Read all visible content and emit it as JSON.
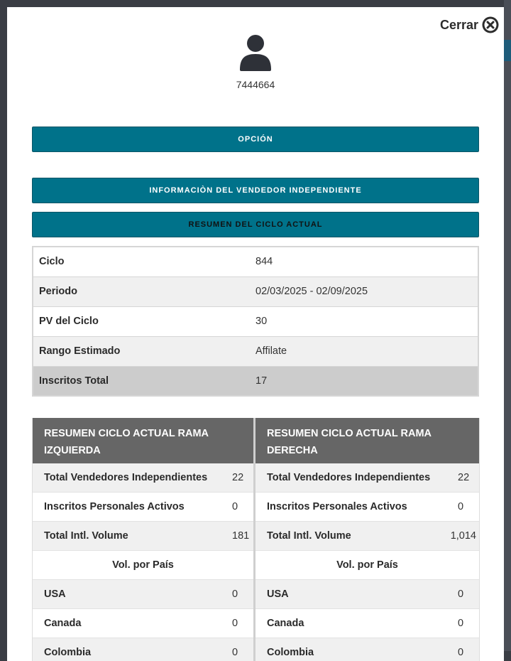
{
  "modal": {
    "close_label": "Cerrar",
    "user_id": "7444664"
  },
  "buttons": {
    "option": "OPCIÓN",
    "vendor_info": "INFORMACIÒN DEL VENDEDOR INDEPENDIENTE",
    "cycle_summary": "RESUMEN DEL CICLO ACTUAL"
  },
  "summary": [
    {
      "label": "Ciclo",
      "value": "844"
    },
    {
      "label": "Periodo",
      "value": "02/03/2025 - 02/09/2025"
    },
    {
      "label": "PV del Ciclo",
      "value": "30"
    },
    {
      "label": "Rango Estimado",
      "value": "Affilate"
    },
    {
      "label": "Inscritos Total",
      "value": "17"
    }
  ],
  "left": {
    "title": "RESUMEN CICLO ACTUAL RAMA IZQUIERDA",
    "rows": [
      {
        "label": "Total Vendedores Independientes",
        "value": "22"
      },
      {
        "label": "Inscritos Personales Activos",
        "value": "0"
      },
      {
        "label": "Total Intl. Volume",
        "value": "181"
      },
      {
        "label": "Vol. por País",
        "value": ""
      },
      {
        "label": "USA",
        "value": "0"
      },
      {
        "label": "Canada",
        "value": "0"
      },
      {
        "label": "Colombia",
        "value": "0"
      }
    ]
  },
  "right": {
    "title": "RESUMEN CICLO ACTUAL RAMA DERECHA",
    "rows": [
      {
        "label": "Total Vendedores Independientes",
        "value": "22"
      },
      {
        "label": "Inscritos Personales Activos",
        "value": "0"
      },
      {
        "label": "Total Intl. Volume",
        "value": "1,014"
      },
      {
        "label": "Vol. por País",
        "value": ""
      },
      {
        "label": "USA",
        "value": "0"
      },
      {
        "label": "Canada",
        "value": "0"
      },
      {
        "label": "Colombia",
        "value": "0"
      }
    ]
  },
  "colors": {
    "button_teal": "#00728a",
    "header_gray": "#666666"
  },
  "icons": {
    "close": "close-circle-icon",
    "avatar": "user-icon"
  }
}
